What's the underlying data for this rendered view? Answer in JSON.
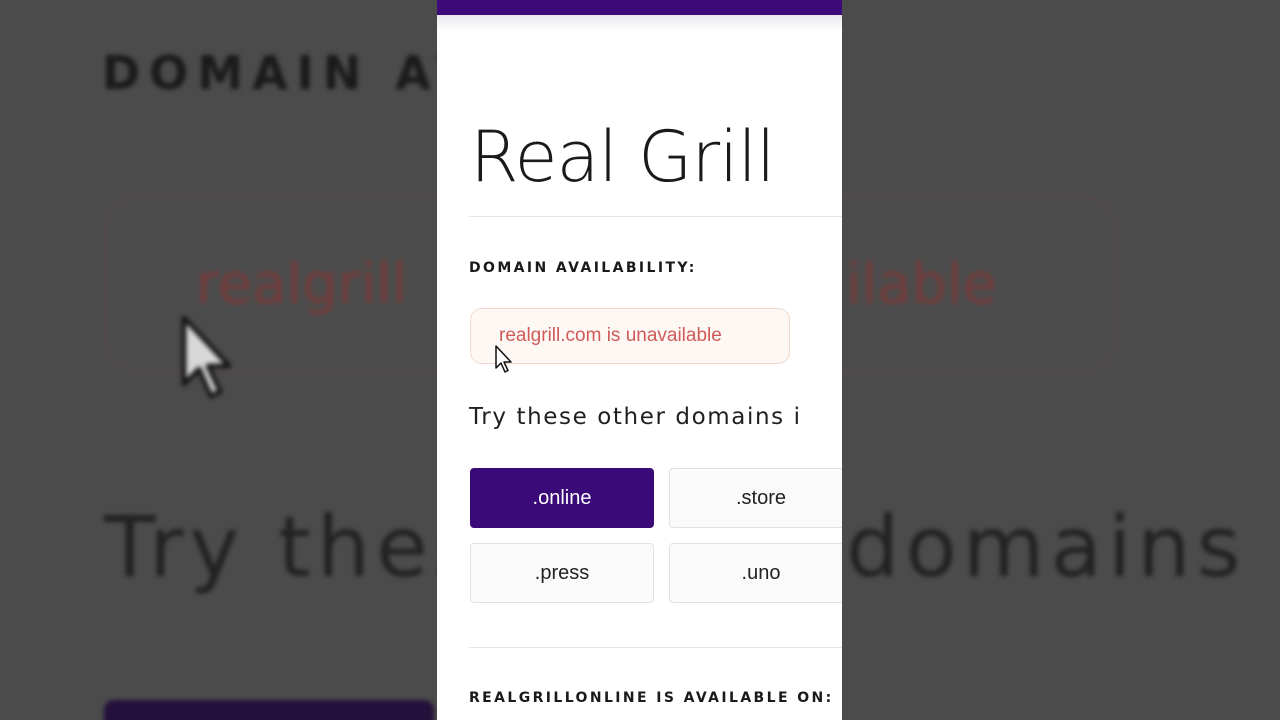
{
  "background": {
    "heading": "DOMAIN AV",
    "status_left": "realgrill",
    "status_right": "ilable",
    "try_left": "Try thes",
    "try_right": "domains i"
  },
  "site": {
    "title": "Real Grill"
  },
  "availability": {
    "label": "DOMAIN AVAILABILITY:",
    "status_text": "realgrill.com is unavailable"
  },
  "suggestions": {
    "heading": "Try these other domains i",
    "tlds": [
      {
        "label": ".online",
        "selected": true
      },
      {
        "label": ".store",
        "selected": false
      },
      {
        "label": ".press",
        "selected": false
      },
      {
        "label": ".uno",
        "selected": false
      }
    ]
  },
  "result": {
    "label": "REALGRILLONLINE IS AVAILABLE ON:"
  },
  "colors": {
    "accent": "#3a0a78",
    "unavailable": "#d05a5a"
  }
}
